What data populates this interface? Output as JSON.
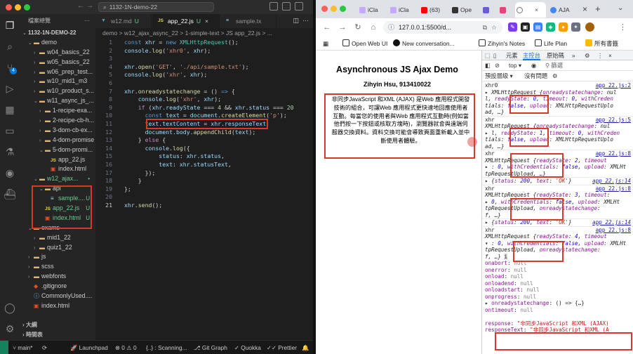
{
  "vscode": {
    "title": "1132-1N-demo-22",
    "explorer_title": "檔案總覽",
    "root": "1132-1N-DEMO-22",
    "tree": [
      {
        "label": "demo",
        "kind": "folder-open",
        "depth": 1,
        "mark": ""
      },
      {
        "label": "w04_basics_22",
        "kind": "folder",
        "depth": 2,
        "mark": ""
      },
      {
        "label": "w05_basics_22",
        "kind": "folder",
        "depth": 2,
        "mark": ""
      },
      {
        "label": "w06_prep_test...",
        "kind": "folder",
        "depth": 2,
        "mark": ""
      },
      {
        "label": "w10_mid1_m3",
        "kind": "folder",
        "depth": 2,
        "mark": ""
      },
      {
        "label": "w10_product_s...",
        "kind": "folder",
        "depth": 2,
        "mark": ""
      },
      {
        "label": "w11_async_js_...",
        "kind": "folder-open",
        "depth": 2,
        "mark": ""
      },
      {
        "label": "1-recipe-exa...",
        "kind": "folder",
        "depth": 3,
        "mark": ""
      },
      {
        "label": "2-recipe-cb-h...",
        "kind": "folder",
        "depth": 3,
        "mark": ""
      },
      {
        "label": "3-dom-cb-ex...",
        "kind": "folder",
        "depth": 3,
        "mark": ""
      },
      {
        "label": "4-dom-promise",
        "kind": "folder",
        "depth": 3,
        "mark": ""
      },
      {
        "label": "5-dom-promi...",
        "kind": "folder-open",
        "depth": 3,
        "mark": ""
      },
      {
        "label": "app_22.js",
        "kind": "js",
        "depth": 4,
        "mark": ""
      },
      {
        "label": "index.html",
        "kind": "html",
        "depth": 4,
        "mark": ""
      },
      {
        "label": "w12_ajax...",
        "kind": "folder-open",
        "depth": 2,
        "mark": "•"
      },
      {
        "label": "api",
        "kind": "folder-open",
        "depth": 3,
        "mark": ""
      },
      {
        "label": "sample....",
        "kind": "txt",
        "depth": 4,
        "mark": "U"
      },
      {
        "label": "app_22.js",
        "kind": "js",
        "depth": 3,
        "mark": "U"
      },
      {
        "label": "index.html",
        "kind": "html",
        "depth": 3,
        "mark": "U"
      },
      {
        "label": "exams",
        "kind": "folder-open",
        "depth": 1,
        "mark": ""
      },
      {
        "label": "mid1_22",
        "kind": "folder",
        "depth": 2,
        "mark": ""
      },
      {
        "label": "quiz1_22",
        "kind": "folder",
        "depth": 2,
        "mark": ""
      },
      {
        "label": "js",
        "kind": "folder",
        "depth": 1,
        "mark": ""
      },
      {
        "label": "scss",
        "kind": "folder",
        "depth": 1,
        "mark": ""
      },
      {
        "label": "webfonts",
        "kind": "folder",
        "depth": 1,
        "mark": ""
      },
      {
        "label": ".gitignore",
        "kind": "git",
        "depth": 1,
        "mark": ""
      },
      {
        "label": "CommonlyUsed....",
        "kind": "info",
        "depth": 1,
        "mark": ""
      },
      {
        "label": "index.html",
        "kind": "html",
        "depth": 1,
        "mark": ""
      }
    ],
    "outline_label": "大綱",
    "timeline_label": "時間表",
    "tabs": [
      {
        "label": "w12.md",
        "mark": "U"
      },
      {
        "label": "app_22.js",
        "mark": "U"
      },
      {
        "label": "sample.tx",
        "mark": ""
      }
    ],
    "breadcrumb": "demo > w12_ajax_async_22 > 1-simple-text > JS app_22.js > ...",
    "line_numbers": [
      "1",
      "2",
      "3",
      "4",
      "5",
      "6",
      "7",
      "8",
      "9",
      "10",
      "11",
      "12",
      "13",
      "14",
      "15",
      "16",
      "17",
      "18",
      "19",
      "20",
      "21"
    ],
    "status": {
      "branch": "main*",
      "sync": "⟳",
      "launchpad": "Launchpad",
      "errors": "0",
      "warnings": "0",
      "scanning": "{..} : Scanning...",
      "gitgraph": "Git Graph",
      "quokka": "Quokka",
      "prettier": "Prettier"
    }
  },
  "chrome": {
    "tabs": [
      "iCla",
      "iCla",
      "(63)",
      "Ope",
      "",
      "",
      "AJA"
    ],
    "url": "127.0.0.1:5500/d...",
    "bookmarks": [
      "Open Web UI",
      "New conversation...",
      "Zihyin's Notes",
      "Life Plan",
      "所有書籤"
    ],
    "page": {
      "title": "Asynchronous JS Ajax Demo",
      "author": "Zihyin Hsu, 913410022",
      "text": "非同步JavaScript 和XML (AJAX) 是Web 應用程式開發技術的組合，可讓Web 應用程式更快速地回應使用者互動。每當您的使用者與Web 應用程式互動時(例如當他們按一下按鈕或核取方塊時)，瀏覽器就會與遠端伺服器交換資料。資料交換可能會導致頁面重新載入並中斷使用者體驗。"
    },
    "devtools": {
      "tabs": [
        "元素",
        "主控台",
        "原始碼"
      ],
      "context": "top",
      "filter_placeholder": "篩選",
      "levels": "預設層級",
      "issues": "沒有問題"
    }
  }
}
